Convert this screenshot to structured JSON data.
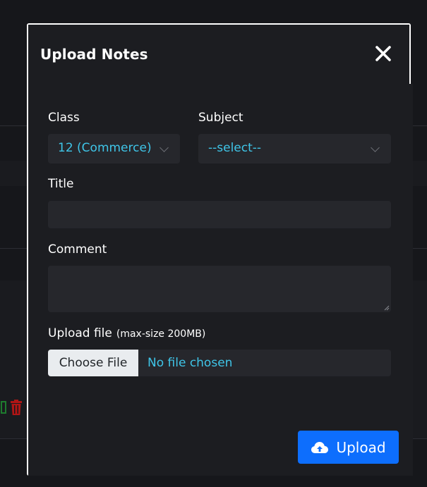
{
  "modal": {
    "title": "Upload Notes",
    "close_icon": "close-icon"
  },
  "form": {
    "class_label": "Class",
    "class_value": "12 (Commerce)",
    "subject_label": "Subject",
    "subject_value": "--select--",
    "title_label": "Title",
    "title_value": "",
    "comment_label": "Comment",
    "comment_value": "",
    "file_label": "Upload file",
    "file_note": "(max-size 200MB)",
    "choose_file_label": "Choose File",
    "file_status": "No file chosen"
  },
  "footer": {
    "upload_label": "Upload",
    "upload_icon": "cloud-upload-icon"
  },
  "background": {
    "icons": [
      "edit-icon",
      "trash-icon"
    ]
  },
  "colors": {
    "accent_text": "#3fc5e8",
    "primary_button": "#0d6efd",
    "field_bg": "#26272c",
    "modal_bg": "#1c1d21"
  }
}
